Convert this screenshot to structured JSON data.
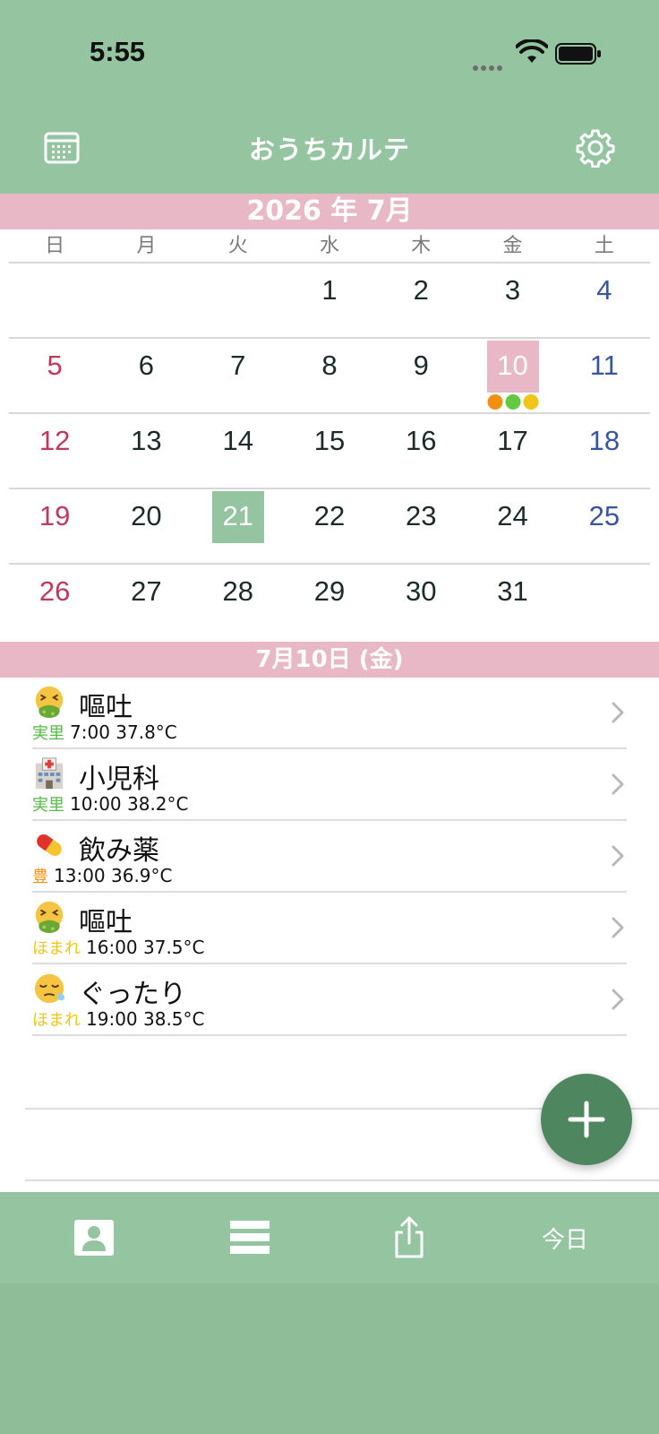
{
  "status_bar": {
    "time": "5:55"
  },
  "header": {
    "title": "おうちカルテ",
    "calendar_icon": "calendar-icon",
    "settings_icon": "gear-icon"
  },
  "calendar": {
    "month_label": "2026 年 7月",
    "weekdays": [
      "日",
      "月",
      "火",
      "水",
      "木",
      "金",
      "土"
    ],
    "weeks": [
      [
        "",
        "",
        "",
        "1",
        "2",
        "3",
        "4"
      ],
      [
        "5",
        "6",
        "7",
        "8",
        "9",
        "10",
        "11"
      ],
      [
        "12",
        "13",
        "14",
        "15",
        "16",
        "17",
        "18"
      ],
      [
        "19",
        "20",
        "21",
        "22",
        "23",
        "24",
        "25"
      ],
      [
        "26",
        "27",
        "28",
        "29",
        "30",
        "31",
        ""
      ]
    ],
    "selected_day": "10",
    "today_day": "21",
    "day_markers": {
      "10": [
        "#f0900e",
        "#62c940",
        "#f2c417"
      ]
    },
    "colors": {
      "sunday": "#c0395a",
      "saturday": "#3a55a0",
      "selected_bg": "#e8b8c7",
      "today_bg": "#95c4a0"
    }
  },
  "day_detail": {
    "date_label": "7月10日 (金)",
    "events": [
      {
        "icon": "vomit-face-icon",
        "title": "嘔吐",
        "person": "実里",
        "person_color": "#58b848",
        "detail": "7:00 37.8°C"
      },
      {
        "icon": "hospital-icon",
        "title": "小児科",
        "person": "実里",
        "person_color": "#58b848",
        "detail": "10:00 38.2°C"
      },
      {
        "icon": "pill-icon",
        "title": "飲み薬",
        "person": "豊",
        "person_color": "#f0900e",
        "detail": "13:00 36.9°C"
      },
      {
        "icon": "vomit-face-icon",
        "title": "嘔吐",
        "person": "ほまれ",
        "person_color": "#f2c417",
        "detail": "16:00 37.5°C"
      },
      {
        "icon": "sleepy-face-icon",
        "title": "ぐったり",
        "person": "ほまれ",
        "person_color": "#f2c417",
        "detail": "19:00 38.5°C"
      }
    ]
  },
  "fab": {
    "icon": "plus-icon"
  },
  "tabbar": {
    "tabs": [
      {
        "icon": "person-card-icon"
      },
      {
        "icon": "list-icon"
      },
      {
        "icon": "share-icon"
      },
      {
        "label": "今日"
      }
    ]
  },
  "theme": {
    "primary": "#95c4a0",
    "accent_pink": "#e8b8c7",
    "fab": "#4e8660"
  }
}
